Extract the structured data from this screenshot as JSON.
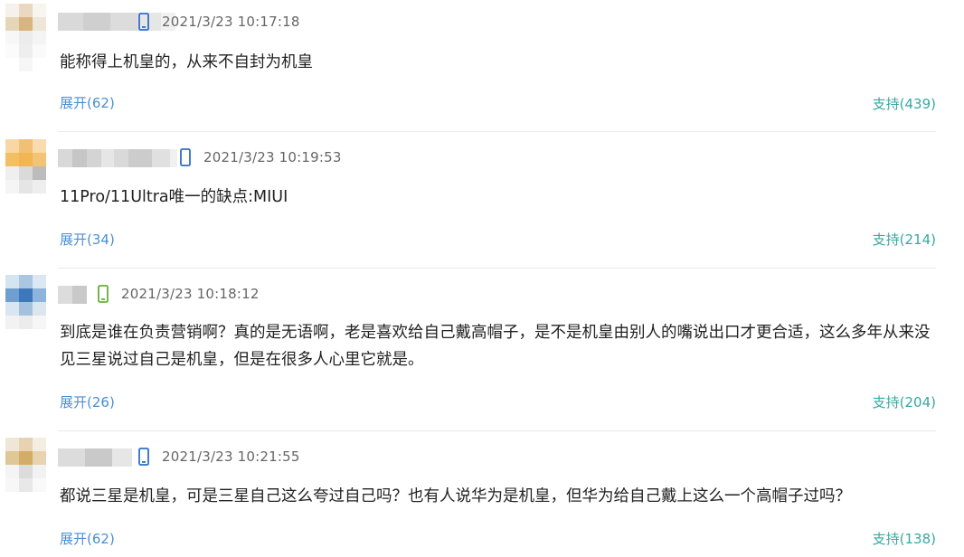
{
  "comments": [
    {
      "timestamp": "2021/3/23 10:17:18",
      "device_icon": "phone-icon",
      "device_color": "#2f6fc5",
      "text": "能称得上机皇的，从来不自封为机皇",
      "expand_label": "展开(62)",
      "support_label": "支持(439)"
    },
    {
      "timestamp": "2021/3/23 10:19:53",
      "device_icon": "phone-icon",
      "device_color": "#2f6fc5",
      "text": "11Pro/11Ultra唯一的缺点:MIUI",
      "expand_label": "展开(34)",
      "support_label": "支持(214)"
    },
    {
      "timestamp": "2021/3/23 10:18:12",
      "device_icon": "phone-icon",
      "device_color": "#6aae3a",
      "text": "到底是谁在负责营销啊？真的是无语啊，老是喜欢给自己戴高帽子，是不是机皇由别人的嘴说出口才更合适，这么多年从来没见三星说过自己是机皇，但是在很多人心里它就是。",
      "expand_label": "展开(26)",
      "support_label": "支持(204)"
    },
    {
      "timestamp": "2021/3/23 10:21:55",
      "device_icon": "phone-icon",
      "device_color": "#2f6fc5",
      "text": "都说三星是机皇，可是三星自己这么夸过自己吗？也有人说华为是机皇，但华为给自己戴上这么一个高帽子过吗？",
      "expand_label": "展开(62)",
      "support_label": "支持(138)"
    }
  ],
  "colors": {
    "expand_link": "#4a8fd4",
    "support_link": "#36a9a0",
    "timestamp": "#666666",
    "comment_text": "#222222",
    "divider": "#e9e9e9"
  }
}
